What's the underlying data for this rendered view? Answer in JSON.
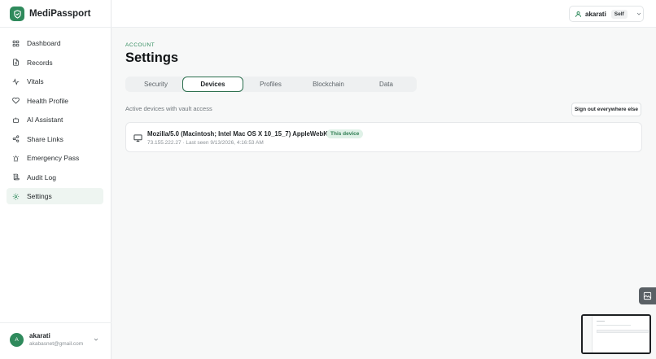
{
  "app": {
    "name": "MediPassport",
    "brand_color": "#2f8a5c"
  },
  "sidebar": {
    "items": [
      {
        "label": "Dashboard",
        "icon": "grid-icon"
      },
      {
        "label": "Records",
        "icon": "file-icon"
      },
      {
        "label": "Vitals",
        "icon": "activity-icon"
      },
      {
        "label": "Health Profile",
        "icon": "heart-icon"
      },
      {
        "label": "AI Assistant",
        "icon": "bot-icon"
      },
      {
        "label": "Share Links",
        "icon": "share-icon"
      },
      {
        "label": "Emergency Pass",
        "icon": "siren-icon"
      },
      {
        "label": "Audit Log",
        "icon": "scroll-icon"
      },
      {
        "label": "Settings",
        "icon": "gear-icon",
        "active": true
      }
    ],
    "user": {
      "initial": "A",
      "name": "akarati",
      "email": "akabasnet@gmail.com"
    }
  },
  "header": {
    "profile_name": "akarati",
    "profile_badge": "Self"
  },
  "page": {
    "eyebrow": "ACCOUNT",
    "title": "Settings",
    "tabs": [
      {
        "label": "Security",
        "active": false
      },
      {
        "label": "Devices",
        "active": true
      },
      {
        "label": "Profiles",
        "active": false
      },
      {
        "label": "Blockchain",
        "active": false
      },
      {
        "label": "Data",
        "active": false
      }
    ],
    "section_label": "Active devices with vault access",
    "signout_label": "Sign out everywhere else",
    "devices": [
      {
        "user_agent": "Mozilla/5.0 (Macintosh; Intel Mac OS X 10_15_7) AppleWebKit/",
        "badge": "This device",
        "meta": "73.155.222.27 · Last seen 9/13/2026, 4:16:53 AM"
      }
    ]
  }
}
